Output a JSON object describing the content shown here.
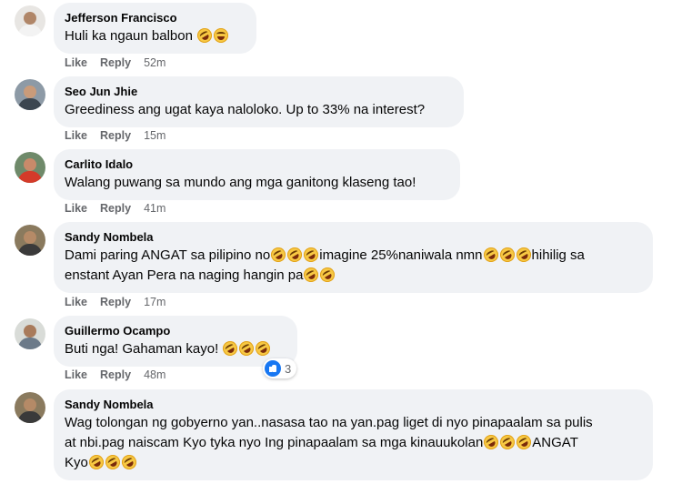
{
  "actions": {
    "like": "Like",
    "reply": "Reply"
  },
  "comments": [
    {
      "author": "Jefferson Francisco",
      "lines": [
        {
          "text": "Huli ka ngaun balbon",
          "emojis": [
            "rofl",
            "smile"
          ]
        }
      ],
      "time": "52m"
    },
    {
      "author": "Seo Jun Jhie",
      "lines": [
        {
          "text": "Greediness ang ugat kaya naloloko. Up to 33% na interest?",
          "emojis": []
        }
      ],
      "time": "15m"
    },
    {
      "author": "Carlito Idalo",
      "lines": [
        {
          "text": "Walang puwang sa mundo ang mga ganitong klaseng tao!",
          "emojis": []
        }
      ],
      "time": "41m"
    },
    {
      "author": "Sandy Nombela",
      "lines": [
        {
          "segments": [
            "Dami paring ANGAT sa pilipino no",
            "imagine 25%naniwala nmn",
            "hihilig sa"
          ],
          "emoji_groups": [
            3,
            3,
            0
          ]
        },
        {
          "segments": [
            "enstant Ayan Pera na naging hangin pa"
          ],
          "emoji_groups": [
            2
          ]
        }
      ],
      "time": "17m"
    },
    {
      "author": "Guillermo Ocampo",
      "lines": [
        {
          "text": "Buti nga! Gahaman kayo!",
          "emojis": [
            "rofl",
            "rofl",
            "rofl"
          ]
        }
      ],
      "time": "48m",
      "reaction_count": "3"
    },
    {
      "author": "Sandy Nombela",
      "lines": [
        {
          "segments": [
            "Wag tolongan ng gobyerno yan..nasasa tao na yan.pag liget di nyo pinapaalam sa pulis"
          ],
          "emoji_groups": [
            0
          ]
        },
        {
          "segments": [
            "at nbi.pag naiscam Kyo tyka nyo Ing pinapaalam sa mga kinauukolan",
            "ANGAT"
          ],
          "emoji_groups": [
            3,
            0
          ]
        },
        {
          "segments": [
            "Kyo"
          ],
          "emoji_groups": [
            3
          ]
        }
      ],
      "time": ""
    }
  ],
  "colors": {
    "bubble": "#f0f2f5",
    "meta": "#65676b",
    "like_blue": "#1877f2"
  }
}
